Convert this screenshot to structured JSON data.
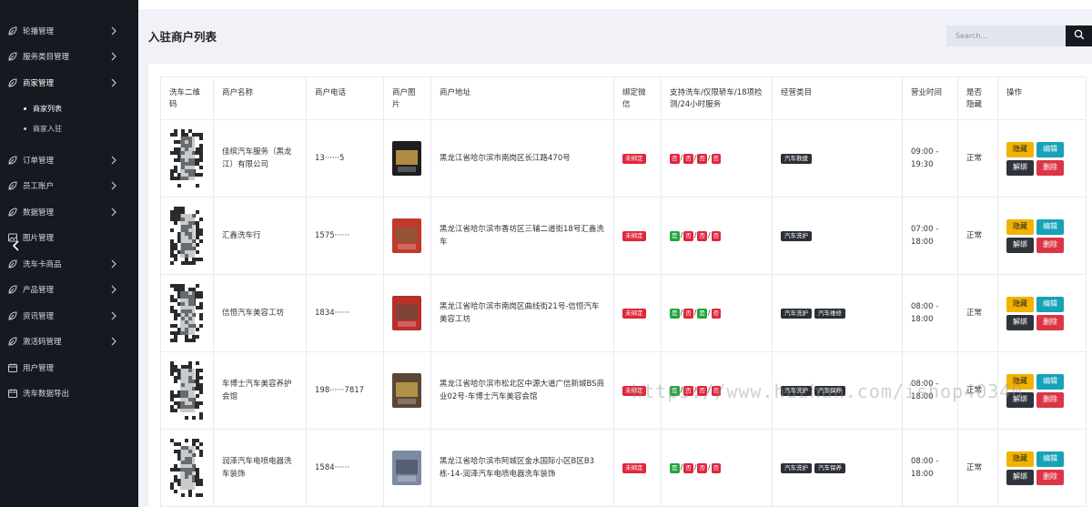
{
  "sidebar": {
    "menu": [
      {
        "label": "轮播管理",
        "icon": "leaf-icon"
      },
      {
        "label": "服务类目管理",
        "icon": "leaf-icon"
      },
      {
        "label": "商家管理",
        "icon": "leaf-icon"
      },
      {
        "label": "订单管理",
        "icon": "leaf-icon"
      },
      {
        "label": "员工账户",
        "icon": "leaf-icon"
      },
      {
        "label": "数据管理",
        "icon": "leaf-icon"
      },
      {
        "label": "图片管理",
        "icon": "image-icon"
      },
      {
        "label": "洗车卡商品",
        "icon": "leaf-icon"
      },
      {
        "label": "产品管理",
        "icon": "leaf-icon"
      },
      {
        "label": "资讯管理",
        "icon": "leaf-icon"
      },
      {
        "label": "激活码管理",
        "icon": "leaf-icon"
      },
      {
        "label": "用户管理",
        "icon": "calendar-icon"
      },
      {
        "label": "洗车数据导出",
        "icon": "calendar-icon"
      }
    ],
    "submenu": [
      {
        "label": "商家列表"
      },
      {
        "label": "商家入驻"
      }
    ]
  },
  "header": {
    "title": "入驻商户列表",
    "search_placeholder": "Search..."
  },
  "table": {
    "columns": [
      "洗车二维码",
      "商户名称",
      "商户电话",
      "商户图片",
      "商户地址",
      "绑定微信",
      "支持洗车/仅限轿车/18项检测/24小时服务",
      "经营类目",
      "营业时间",
      "是否隐藏",
      "操作"
    ],
    "rows": [
      {
        "name": "佳缤汽车服务（黑龙江）有限公司",
        "phone": "13······5",
        "address": "黑龙江省哈尔滨市南岗区长江路470号",
        "wechat": "未绑定",
        "flags": [
          "否",
          "否",
          "否",
          "否"
        ],
        "categories": [
          "汽车救援"
        ],
        "hours": "09:00 - 19:30",
        "hidden": "正常"
      },
      {
        "name": "汇鑫洗车行",
        "phone": "1575······",
        "address": "黑龙江省哈尔滨市香坊区三辅二道街18号汇鑫洗车",
        "wechat": "未绑定",
        "flags": [
          "是",
          "否",
          "否",
          "否"
        ],
        "categories": [
          "汽车洗护"
        ],
        "hours": "07:00 - 18:00",
        "hidden": "正常"
      },
      {
        "name": "信恒汽车美容工坊",
        "phone": "1834······",
        "address": "黑龙江省哈尔滨市南岗区曲线街21号-信恒汽车美容工坊",
        "wechat": "未绑定",
        "flags": [
          "是",
          "否",
          "是",
          "否"
        ],
        "categories": [
          "汽车洗护",
          "汽车维修"
        ],
        "hours": "08:00 - 18:00",
        "hidden": "正常"
      },
      {
        "name": "车博士汽车美容养护会馆",
        "phone": "198······7817",
        "address": "黑龙江省哈尔滨市松北区中源大道广信新城BS商业02号-车博士汽车美容会馆",
        "wechat": "未绑定",
        "flags": [
          "是",
          "否",
          "否",
          "否"
        ],
        "categories": [
          "汽车洗护",
          "汽车保养"
        ],
        "hours": "08:00 - 18:00",
        "hidden": "正常"
      },
      {
        "name": "润泽汽车电喷电器洗车装饰",
        "phone": "1584······",
        "address": "黑龙江省哈尔滨市阿城区金水国际小区B区B3栋-14-润泽汽车电喷电器洗车装饰",
        "wechat": "未绑定",
        "flags": [
          "是",
          "否",
          "否",
          "否"
        ],
        "categories": [
          "汽车洗护",
          "汽车保养"
        ],
        "hours": "08:00 - 18:00",
        "hidden": "正常"
      }
    ],
    "actions": {
      "hide": "隐藏",
      "edit": "编辑",
      "unbind": "解绑",
      "delete": "删除"
    }
  },
  "watermark": "https://www.huzhan.com/ishop40340"
}
